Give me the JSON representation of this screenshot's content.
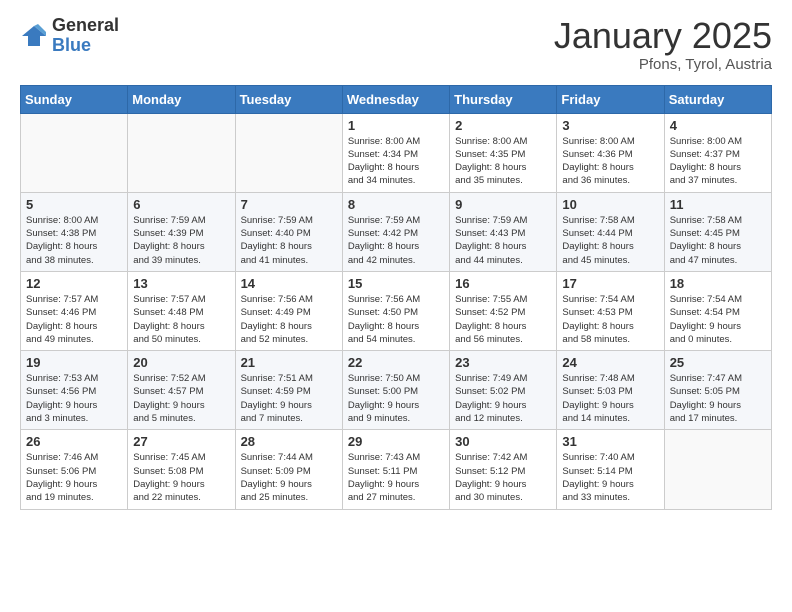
{
  "header": {
    "logo_general": "General",
    "logo_blue": "Blue",
    "month_title": "January 2025",
    "location": "Pfons, Tyrol, Austria"
  },
  "weekdays": [
    "Sunday",
    "Monday",
    "Tuesday",
    "Wednesday",
    "Thursday",
    "Friday",
    "Saturday"
  ],
  "weeks": [
    [
      {
        "day": "",
        "info": ""
      },
      {
        "day": "",
        "info": ""
      },
      {
        "day": "",
        "info": ""
      },
      {
        "day": "1",
        "info": "Sunrise: 8:00 AM\nSunset: 4:34 PM\nDaylight: 8 hours\nand 34 minutes."
      },
      {
        "day": "2",
        "info": "Sunrise: 8:00 AM\nSunset: 4:35 PM\nDaylight: 8 hours\nand 35 minutes."
      },
      {
        "day": "3",
        "info": "Sunrise: 8:00 AM\nSunset: 4:36 PM\nDaylight: 8 hours\nand 36 minutes."
      },
      {
        "day": "4",
        "info": "Sunrise: 8:00 AM\nSunset: 4:37 PM\nDaylight: 8 hours\nand 37 minutes."
      }
    ],
    [
      {
        "day": "5",
        "info": "Sunrise: 8:00 AM\nSunset: 4:38 PM\nDaylight: 8 hours\nand 38 minutes."
      },
      {
        "day": "6",
        "info": "Sunrise: 7:59 AM\nSunset: 4:39 PM\nDaylight: 8 hours\nand 39 minutes."
      },
      {
        "day": "7",
        "info": "Sunrise: 7:59 AM\nSunset: 4:40 PM\nDaylight: 8 hours\nand 41 minutes."
      },
      {
        "day": "8",
        "info": "Sunrise: 7:59 AM\nSunset: 4:42 PM\nDaylight: 8 hours\nand 42 minutes."
      },
      {
        "day": "9",
        "info": "Sunrise: 7:59 AM\nSunset: 4:43 PM\nDaylight: 8 hours\nand 44 minutes."
      },
      {
        "day": "10",
        "info": "Sunrise: 7:58 AM\nSunset: 4:44 PM\nDaylight: 8 hours\nand 45 minutes."
      },
      {
        "day": "11",
        "info": "Sunrise: 7:58 AM\nSunset: 4:45 PM\nDaylight: 8 hours\nand 47 minutes."
      }
    ],
    [
      {
        "day": "12",
        "info": "Sunrise: 7:57 AM\nSunset: 4:46 PM\nDaylight: 8 hours\nand 49 minutes."
      },
      {
        "day": "13",
        "info": "Sunrise: 7:57 AM\nSunset: 4:48 PM\nDaylight: 8 hours\nand 50 minutes."
      },
      {
        "day": "14",
        "info": "Sunrise: 7:56 AM\nSunset: 4:49 PM\nDaylight: 8 hours\nand 52 minutes."
      },
      {
        "day": "15",
        "info": "Sunrise: 7:56 AM\nSunset: 4:50 PM\nDaylight: 8 hours\nand 54 minutes."
      },
      {
        "day": "16",
        "info": "Sunrise: 7:55 AM\nSunset: 4:52 PM\nDaylight: 8 hours\nand 56 minutes."
      },
      {
        "day": "17",
        "info": "Sunrise: 7:54 AM\nSunset: 4:53 PM\nDaylight: 8 hours\nand 58 minutes."
      },
      {
        "day": "18",
        "info": "Sunrise: 7:54 AM\nSunset: 4:54 PM\nDaylight: 9 hours\nand 0 minutes."
      }
    ],
    [
      {
        "day": "19",
        "info": "Sunrise: 7:53 AM\nSunset: 4:56 PM\nDaylight: 9 hours\nand 3 minutes."
      },
      {
        "day": "20",
        "info": "Sunrise: 7:52 AM\nSunset: 4:57 PM\nDaylight: 9 hours\nand 5 minutes."
      },
      {
        "day": "21",
        "info": "Sunrise: 7:51 AM\nSunset: 4:59 PM\nDaylight: 9 hours\nand 7 minutes."
      },
      {
        "day": "22",
        "info": "Sunrise: 7:50 AM\nSunset: 5:00 PM\nDaylight: 9 hours\nand 9 minutes."
      },
      {
        "day": "23",
        "info": "Sunrise: 7:49 AM\nSunset: 5:02 PM\nDaylight: 9 hours\nand 12 minutes."
      },
      {
        "day": "24",
        "info": "Sunrise: 7:48 AM\nSunset: 5:03 PM\nDaylight: 9 hours\nand 14 minutes."
      },
      {
        "day": "25",
        "info": "Sunrise: 7:47 AM\nSunset: 5:05 PM\nDaylight: 9 hours\nand 17 minutes."
      }
    ],
    [
      {
        "day": "26",
        "info": "Sunrise: 7:46 AM\nSunset: 5:06 PM\nDaylight: 9 hours\nand 19 minutes."
      },
      {
        "day": "27",
        "info": "Sunrise: 7:45 AM\nSunset: 5:08 PM\nDaylight: 9 hours\nand 22 minutes."
      },
      {
        "day": "28",
        "info": "Sunrise: 7:44 AM\nSunset: 5:09 PM\nDaylight: 9 hours\nand 25 minutes."
      },
      {
        "day": "29",
        "info": "Sunrise: 7:43 AM\nSunset: 5:11 PM\nDaylight: 9 hours\nand 27 minutes."
      },
      {
        "day": "30",
        "info": "Sunrise: 7:42 AM\nSunset: 5:12 PM\nDaylight: 9 hours\nand 30 minutes."
      },
      {
        "day": "31",
        "info": "Sunrise: 7:40 AM\nSunset: 5:14 PM\nDaylight: 9 hours\nand 33 minutes."
      },
      {
        "day": "",
        "info": ""
      }
    ]
  ]
}
